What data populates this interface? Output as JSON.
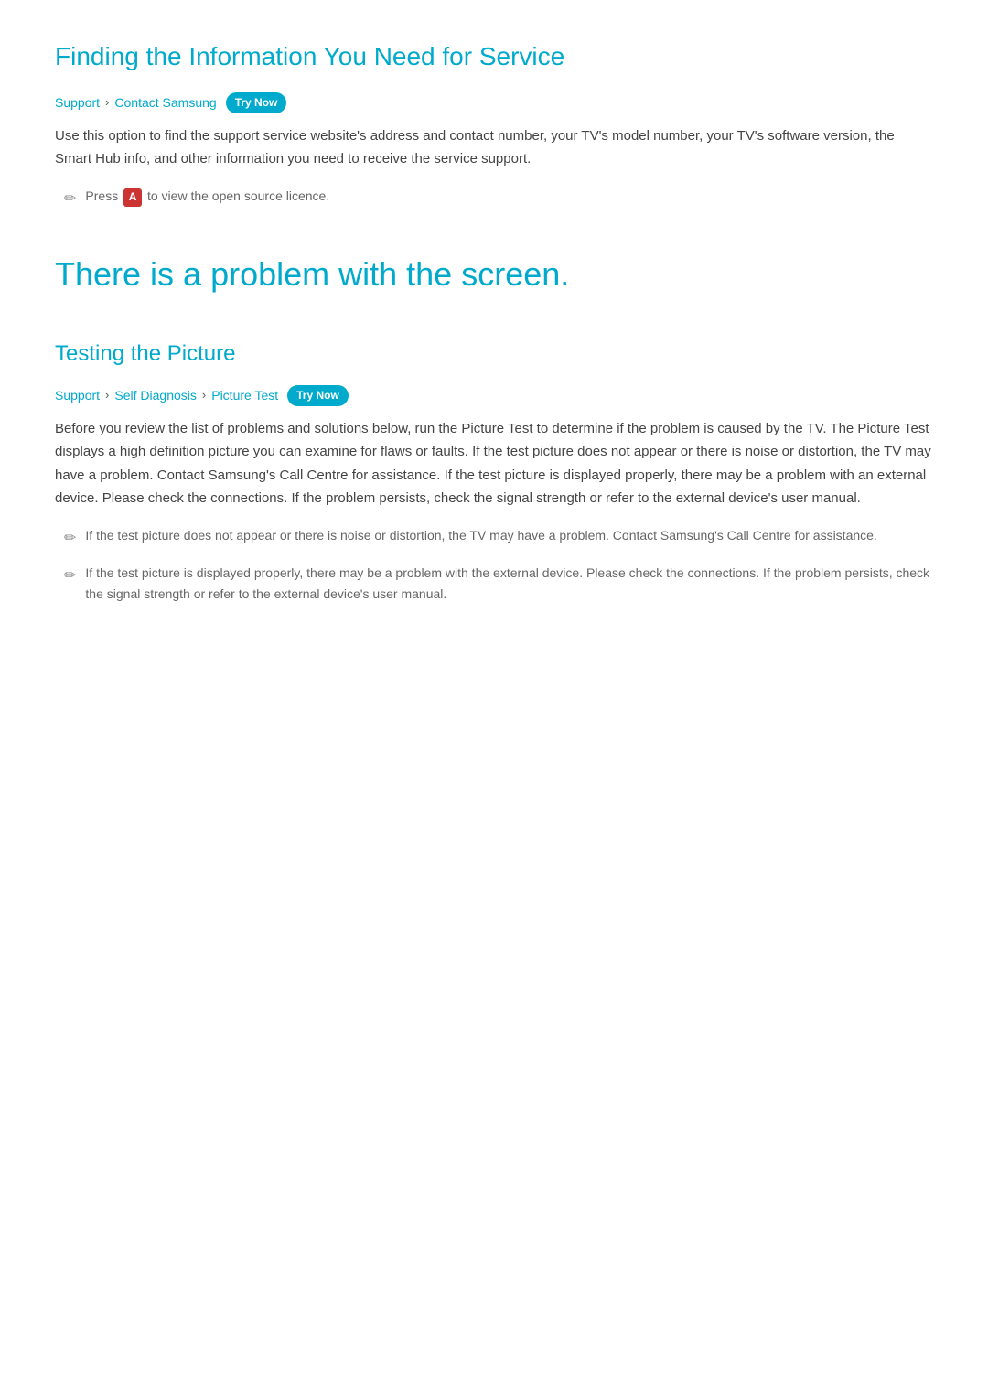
{
  "page": {
    "sections": {
      "finding_info": {
        "title": "Finding the Information You Need for Service",
        "breadcrumb": {
          "items": [
            "Support",
            "Contact Samsung"
          ],
          "separator": "›",
          "badge": "Try Now"
        },
        "body": "Use this option to find the support service website's address and contact number, your TV's model number, your TV's software version, the Smart Hub info, and other information you need to receive the service support.",
        "note": {
          "icon": "✏",
          "text_prefix": "Press",
          "key": "A",
          "text_suffix": "to view the open source licence."
        }
      },
      "screen_problem": {
        "title": "There is a problem with the screen."
      },
      "testing_picture": {
        "title": "Testing the Picture",
        "breadcrumb": {
          "items": [
            "Support",
            "Self Diagnosis",
            "Picture Test"
          ],
          "separator": "›",
          "badge": "Try Now"
        },
        "body": "Before you review the list of problems and solutions below, run the Picture Test to determine if the problem is caused by the TV. The Picture Test displays a high definition picture you can examine for flaws or faults. If the test picture does not appear or there is noise or distortion, the TV may have a problem. Contact Samsung's Call Centre for assistance. If the test picture is displayed properly, there may be a problem with an external device. Please check the connections. If the problem persists, check the signal strength or refer to the external device's user manual.",
        "notes": [
          {
            "icon": "✏",
            "text": "If the test picture does not appear or there is noise or distortion, the TV may have a problem. Contact Samsung's Call Centre for assistance."
          },
          {
            "icon": "✏",
            "text": "If the test picture is displayed properly, there may be a problem with the external device. Please check the connections. If the problem persists, check the signal strength or refer to the external device's user manual."
          }
        ]
      }
    }
  }
}
